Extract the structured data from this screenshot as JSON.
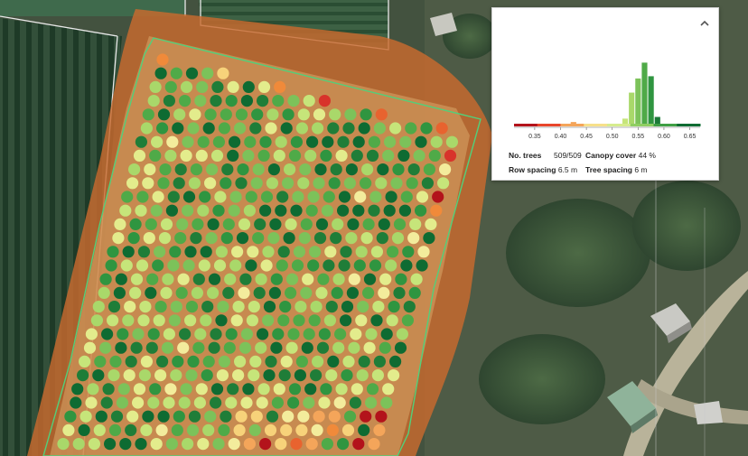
{
  "panel": {
    "stats": {
      "trees_label": "No. trees",
      "trees_value": "509/509",
      "canopy_label": "Canopy cover",
      "canopy_value": "44 %",
      "row_spacing_label": "Row spacing",
      "row_spacing_value": "6.5 m",
      "tree_spacing_label": "Tree spacing",
      "tree_spacing_value": "6 m"
    },
    "collapse_icon": "chevron-up-icon"
  },
  "chart_data": {
    "type": "bar",
    "xlim": [
      0.31,
      0.67
    ],
    "ticks": [
      "0.35",
      "0.40",
      "0.45",
      "0.50",
      "0.55",
      "0.60",
      "0.65"
    ],
    "tick_values": [
      0.35,
      0.4,
      0.45,
      0.5,
      0.55,
      0.6,
      0.65
    ],
    "bin_width": 0.0125,
    "bins": [
      {
        "x": 0.425,
        "count": 3,
        "color": "#f4a55a"
      },
      {
        "x": 0.525,
        "count": 9,
        "color": "#c6e57a"
      },
      {
        "x": 0.5375,
        "count": 55,
        "color": "#a9d86a"
      },
      {
        "x": 0.55,
        "count": 80,
        "color": "#7cc25a"
      },
      {
        "x": 0.5625,
        "count": 108,
        "color": "#4faa48"
      },
      {
        "x": 0.575,
        "count": 84,
        "color": "#2f9540"
      },
      {
        "x": 0.5875,
        "count": 12,
        "color": "#1b7a38"
      }
    ],
    "ymax": 115,
    "colorscale": [
      "#b3131b",
      "#e8462b",
      "#f4a55a",
      "#f7e08a",
      "#d6ec8e",
      "#8fce62",
      "#3f9f45",
      "#0e6b32"
    ]
  },
  "orchard": {
    "tree_colors": [
      "#0e6b32",
      "#1f7d38",
      "#2f9540",
      "#4faa48",
      "#7cc25a",
      "#a9d86a",
      "#c6e57a",
      "#e3ec8c"
    ],
    "edge_colors": [
      "#b3131b",
      "#d8332b",
      "#e8632f",
      "#f08a3a",
      "#f4a55a",
      "#f7d27a",
      "#f3ec9c"
    ]
  }
}
